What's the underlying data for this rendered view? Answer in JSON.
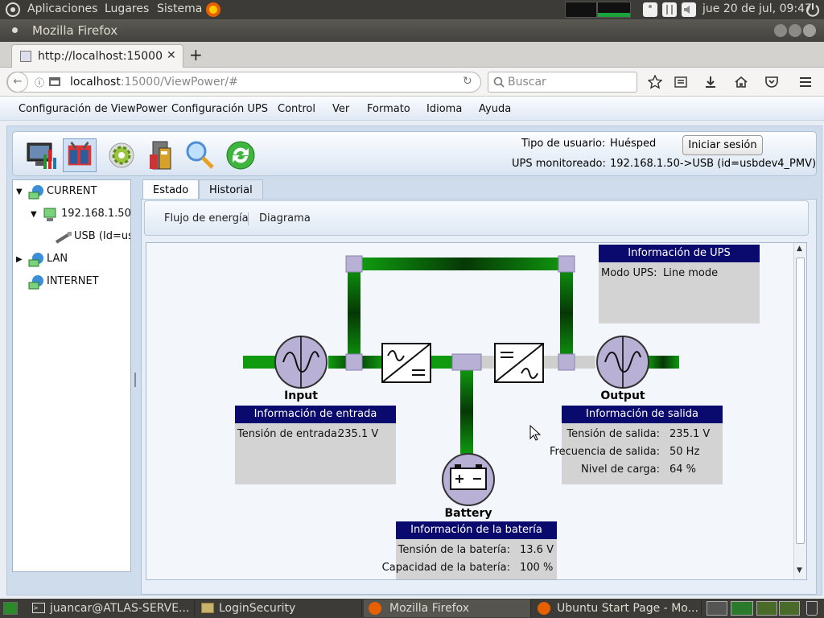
{
  "topbar": {
    "menus": [
      "Aplicaciones",
      "Lugares",
      "Sistema"
    ],
    "clock": "jue 20 de jul, 09:47"
  },
  "window": {
    "title": "Mozilla Firefox"
  },
  "browser": {
    "tab_title": "http://localhost:15000",
    "url_host": "localhost",
    "url_rest": ":15000/ViewPower/#",
    "search_placeholder": "Buscar"
  },
  "app": {
    "menu": [
      "Configuración de ViewPower",
      "Configuración UPS",
      "Control",
      "Ver",
      "Formato",
      "Idioma",
      "Ayuda"
    ],
    "user_type_label": "Tipo de usuario:",
    "user_type_value": "Huésped",
    "login_button": "Iniciar sesión",
    "ups_monitored_label": "UPS monitoreado:",
    "ups_monitored_value": "192.168.1.50->USB (id=usbdev4_PMV)",
    "tree": {
      "current": "CURRENT",
      "ip": "192.168.1.50",
      "usb": "USB (Id=us",
      "lan": "LAN",
      "internet": "INTERNET"
    },
    "tabs": [
      "Estado",
      "Historial"
    ],
    "subtabs": [
      "Flujo de energía",
      "Diagrama"
    ],
    "diagram": {
      "input_label": "Input",
      "output_label": "Output",
      "battery_label": "Battery",
      "ups_info": {
        "title": "Información de UPS",
        "mode_label": "Modo UPS:",
        "mode_value": "Line mode"
      },
      "input_info": {
        "title": "Información de entrada",
        "voltage_label": "Tensión de entrada:",
        "voltage_value": "235.1 V"
      },
      "output_info": {
        "title": "Información de salida",
        "voltage_label": "Tensión de salida:",
        "voltage_value": "235.1 V",
        "freq_label": "Frecuencia de salida:",
        "freq_value": "50 Hz",
        "load_label": "Nivel de carga:",
        "load_value": "64 %"
      },
      "battery_info": {
        "title": "Información de la batería",
        "voltage_label": "Tensión de la batería:",
        "voltage_value": "13.6 V",
        "capacity_label": "Capacidad de la batería:",
        "capacity_value": "100 %"
      }
    }
  },
  "taskbar": {
    "items": [
      "juancar@ATLAS-SERVE...",
      "LoginSecurity",
      "Mozilla Firefox",
      "Ubuntu Start Page - Mo..."
    ]
  },
  "colors": {
    "header_blue": "#0a0a6e",
    "flow_green": "#0d7a0d",
    "node_purple": "#b9b0d6"
  }
}
